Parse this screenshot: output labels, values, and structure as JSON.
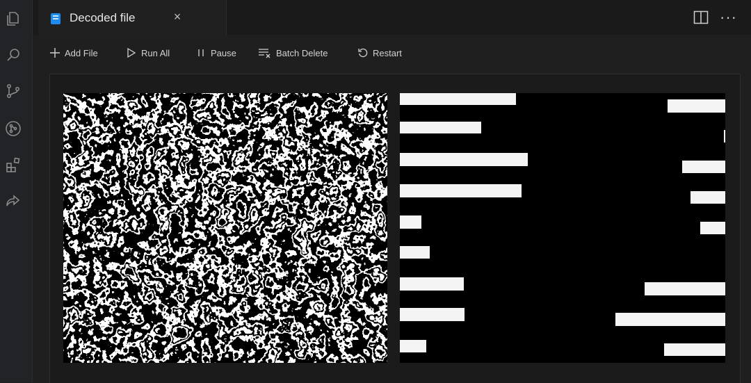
{
  "activity_bar": {
    "icons": [
      "files-icon",
      "search-icon",
      "source-control-icon",
      "git-graph-icon",
      "extensions-icon",
      "share-icon"
    ]
  },
  "tab": {
    "title": "Decoded file",
    "close_glyph": "×"
  },
  "toolbar": {
    "add_file": "Add File",
    "run_all": "Run All",
    "pause": "Pause",
    "batch_delete": "Batch Delete",
    "restart": "Restart"
  },
  "colors": {
    "accent": "#1e8bf0",
    "background": "#1f1f1f",
    "bars": "#f4f4f4"
  },
  "images": [
    {
      "name": "noise-texture-image"
    },
    {
      "name": "redacted-bars-image"
    }
  ]
}
